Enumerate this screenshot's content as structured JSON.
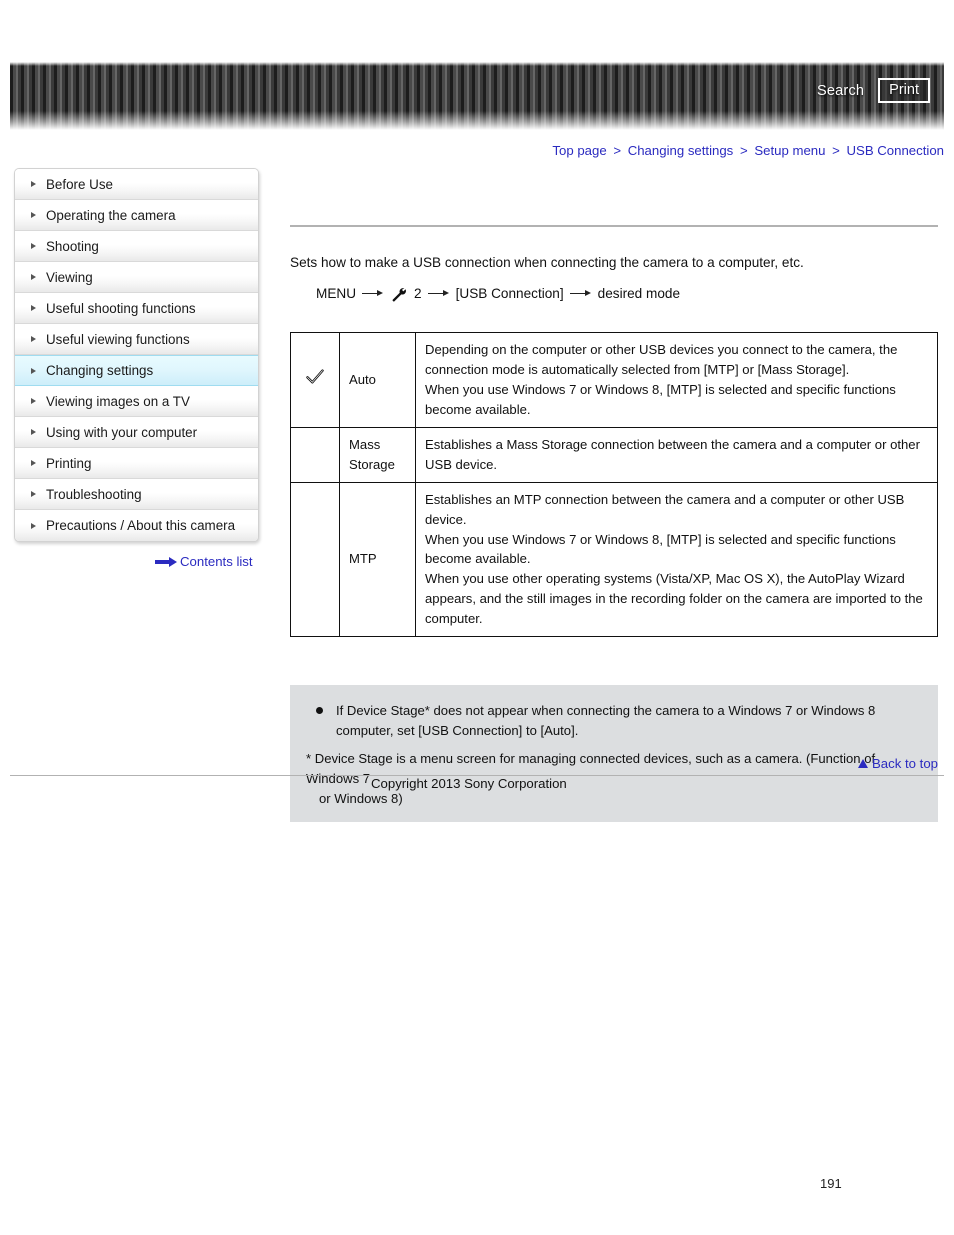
{
  "header": {
    "search_label": "Search",
    "print_label": "Print"
  },
  "breadcrumb": {
    "separator": ">",
    "items": [
      {
        "label": "Top page"
      },
      {
        "label": "Changing settings"
      },
      {
        "label": "Setup menu"
      },
      {
        "label": "USB Connection"
      }
    ]
  },
  "sidebar": {
    "items": [
      {
        "label": "Before Use",
        "active": false
      },
      {
        "label": "Operating the camera",
        "active": false
      },
      {
        "label": "Shooting",
        "active": false
      },
      {
        "label": "Viewing",
        "active": false
      },
      {
        "label": "Useful shooting functions",
        "active": false
      },
      {
        "label": "Useful viewing functions",
        "active": false
      },
      {
        "label": "Changing settings",
        "active": true
      },
      {
        "label": "Viewing images on a TV",
        "active": false
      },
      {
        "label": "Using with your computer",
        "active": false
      },
      {
        "label": "Printing",
        "active": false
      },
      {
        "label": "Troubleshooting",
        "active": false
      },
      {
        "label": "Precautions / About this camera",
        "active": false
      }
    ],
    "contents_list_label": "Contents list"
  },
  "main": {
    "intro": "Sets how to make a USB connection when connecting the camera to a computer, etc.",
    "menu_path": {
      "start": "MENU",
      "setup_number": "2",
      "item": "[USB Connection]",
      "end": "desired mode",
      "icon_name": "wrench-icon"
    },
    "table": {
      "rows": [
        {
          "checked": true,
          "name": "Auto",
          "description": "Depending on the computer or other USB devices you connect to the camera, the connection mode is automatically selected from [MTP] or [Mass Storage].\nWhen you use Windows 7 or Windows 8, [MTP] is selected and specific functions become available."
        },
        {
          "checked": false,
          "name": "Mass Storage",
          "description": "Establishes a Mass Storage connection between the camera and a computer or other USB device."
        },
        {
          "checked": false,
          "name": "MTP",
          "description": "Establishes an MTP connection between the camera and a computer or other USB device.\nWhen you use Windows 7 or Windows 8, [MTP] is selected and specific functions become available.\nWhen you use other operating systems (Vista/XP, Mac OS X), the AutoPlay Wizard appears, and the still images in the recording folder on the camera are imported to the computer."
        }
      ]
    },
    "note": {
      "bullet": "If Device Stage* does not appear when connecting the camera to a Windows 7 or Windows 8 computer, set [USB Connection] to [Auto].",
      "footnote_line1": "* Device Stage is a menu screen for managing connected devices, such as a camera. (Function of Windows 7",
      "footnote_line2": "or Windows 8)"
    }
  },
  "footer": {
    "back_to_top_label": "Back to top",
    "copyright": "Copyright 2013 Sony Corporation",
    "page_number": "191"
  },
  "colors": {
    "link": "#2b2bc0",
    "active_nav": "#cdeefa",
    "note_bg": "#dcdee0",
    "banner_dark": "#1d1d1d"
  }
}
